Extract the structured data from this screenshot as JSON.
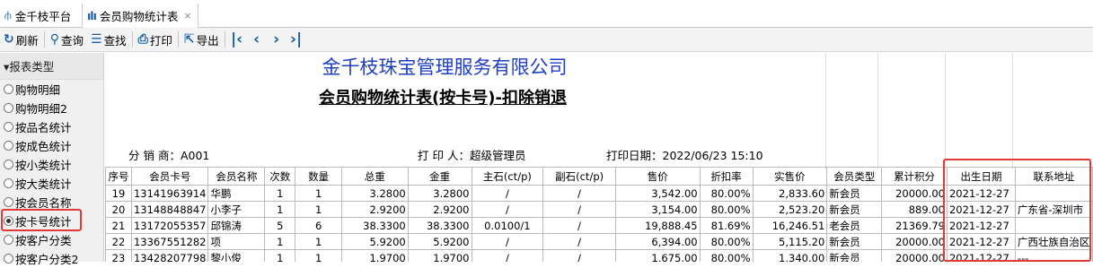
{
  "tabs": [
    {
      "label": "金千枝平台",
      "icon": "app-logo-icon"
    },
    {
      "label": "会员购物统计表",
      "icon": "bar-chart-icon",
      "close": "×"
    }
  ],
  "toolbar": {
    "refresh": "刷新",
    "query": "查询",
    "find": "查找",
    "print": "打印",
    "export": "导出"
  },
  "sidebar": {
    "header": "▾报表类型",
    "items": [
      "购物明细",
      "购物明细2",
      "按品名统计",
      "按成色统计",
      "按小类统计",
      "按大类统计",
      "按会员名称",
      "按卡号统计",
      "按客户分类",
      "按客户分类2"
    ],
    "selected_index": 7
  },
  "report": {
    "company": "金千枝珠宝管理服务有限公司",
    "title": "会员购物统计表(按卡号)-扣除销退",
    "distributor": "分 销 商：A001",
    "printer": "打 印 人：超级管理员",
    "print_date": "打印日期：2022/06/23 15:10"
  },
  "table": {
    "headers": [
      "序号",
      "会员卡号",
      "会员名称",
      "次数",
      "数量",
      "总重",
      "金重",
      "主石(ct/p)",
      "副石(ct/p)",
      "售价",
      "折扣率",
      "实售价",
      "会员类型",
      "累计积分",
      "出生日期",
      "联系地址"
    ],
    "rows": [
      [
        "19",
        "13141963914",
        "华鹏",
        "1",
        "1",
        "3.2800",
        "3.2800",
        "/",
        "/",
        "3,542.00",
        "80.00%",
        "2,833.60",
        "新会员",
        "20000.00",
        "2021-12-27",
        ""
      ],
      [
        "20",
        "13148848847",
        "小李子",
        "1",
        "1",
        "2.9200",
        "2.9200",
        "/",
        "/",
        "3,154.00",
        "80.00%",
        "2,523.20",
        "新会员",
        "889.00",
        "2021-12-27",
        "广东省-深圳市"
      ],
      [
        "21",
        "13172055357",
        "邱锦涛",
        "5",
        "6",
        "38.3300",
        "38.3300",
        "0.0100/1",
        "/",
        "19,888.45",
        "81.69%",
        "16,246.51",
        "老会员",
        "21369.79",
        "2021-12-27",
        ""
      ],
      [
        "22",
        "13367551282",
        "项",
        "1",
        "1",
        "5.9200",
        "5.9200",
        "/",
        "/",
        "6,394.00",
        "80.00%",
        "5,115.20",
        "新会员",
        "20000.00",
        "2021-12-27",
        "广西壮族自治区"
      ],
      [
        "23",
        "13428207798",
        "黎小俊",
        "1",
        "1",
        "1.9700",
        "1.9700",
        "/",
        "/",
        "1,675.00",
        "80.00%",
        "1,340.00",
        "新会员",
        "20000.00",
        "2021-12-27",
        "---"
      ]
    ]
  }
}
